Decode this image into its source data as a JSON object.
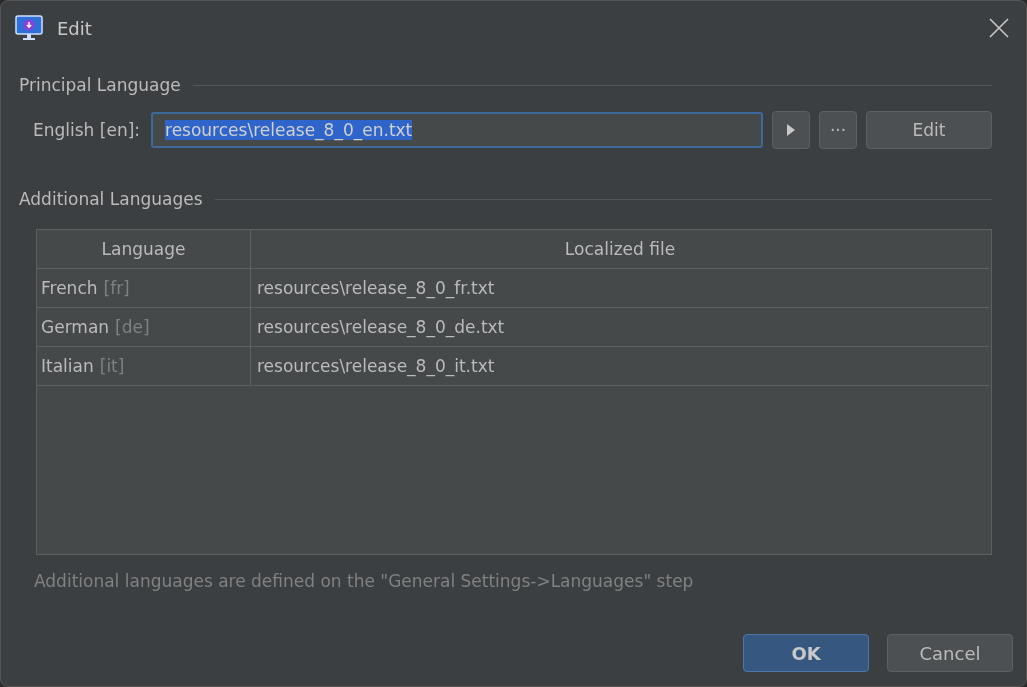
{
  "window": {
    "title": "Edit"
  },
  "principal": {
    "heading": "Principal Language",
    "label": "English [en]:",
    "value": "resources\\release_8_0_en.txt",
    "text_selected": true,
    "buttons": [
      {
        "kind": "play"
      },
      {
        "kind": "text",
        "label": "···"
      },
      {
        "kind": "text",
        "label": "Edit"
      }
    ]
  },
  "additional": {
    "heading": "Additional Languages",
    "columns": [
      "Language",
      "Localized file"
    ],
    "rows": [
      {
        "name": "French",
        "code": "[fr]",
        "file": "resources\\release_8_0_fr.txt"
      },
      {
        "name": "German",
        "code": "[de]",
        "file": "resources\\release_8_0_de.txt"
      },
      {
        "name": "Italian",
        "code": "[it]",
        "file": "resources\\release_8_0_it.txt"
      }
    ],
    "note": "Additional languages are defined on the \"General Settings->Languages\" step"
  },
  "buttons": [
    {
      "label": "OK",
      "default": true
    },
    {
      "label": "Cancel",
      "default": false
    }
  ]
}
